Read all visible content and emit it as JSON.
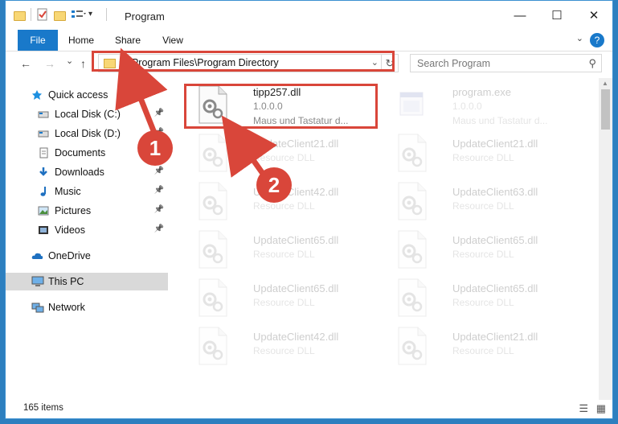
{
  "window": {
    "title": "Program",
    "controls": {
      "minimize": "—",
      "maximize": "☐",
      "close": "✕"
    }
  },
  "ribbon": {
    "tabs": [
      "File",
      "Home",
      "Share",
      "View"
    ],
    "help": "?"
  },
  "nav": {
    "back": "←",
    "forward": "→",
    "recent": "⌄",
    "up": "↑",
    "address_path": "C:\\Program Files\\Program Directory",
    "search_placeholder": "Search Program"
  },
  "sidebar": {
    "items": [
      {
        "label": "Quick access",
        "icon": "star-icon",
        "pinned": false
      },
      {
        "label": "Local Disk (C:)",
        "icon": "drive-icon",
        "pinned": true
      },
      {
        "label": "Local Disk (D:)",
        "icon": "drive-icon",
        "pinned": true
      },
      {
        "label": "Documents",
        "icon": "documents-icon",
        "pinned": true
      },
      {
        "label": "Downloads",
        "icon": "download-icon",
        "pinned": true
      },
      {
        "label": "Music",
        "icon": "music-icon",
        "pinned": true
      },
      {
        "label": "Pictures",
        "icon": "pictures-icon",
        "pinned": true
      },
      {
        "label": "Videos",
        "icon": "videos-icon",
        "pinned": true
      },
      {
        "label": "OneDrive",
        "icon": "cloud-icon",
        "pinned": false
      },
      {
        "label": "This PC",
        "icon": "computer-icon",
        "pinned": false
      },
      {
        "label": "Network",
        "icon": "network-icon",
        "pinned": false
      }
    ]
  },
  "files": [
    {
      "name": "tipp257.dll",
      "line2": "1.0.0.0",
      "line3": "Maus und Tastatur d..."
    },
    {
      "name": "program.exe",
      "line2": "1.0.0.0",
      "line3": "Maus und Tastatur d..."
    },
    {
      "name": "UpdateClient21.dll",
      "line2": "Resource DLL"
    },
    {
      "name": "UpdateClient21.dll",
      "line2": "Resource DLL"
    },
    {
      "name": "UpdateClient42.dll",
      "line2": "Resource DLL"
    },
    {
      "name": "UpdateClient63.dll",
      "line2": "Resource DLL"
    },
    {
      "name": "UpdateClient65.dll",
      "line2": "Resource DLL"
    },
    {
      "name": "UpdateClient65.dll",
      "line2": "Resource DLL"
    },
    {
      "name": "UpdateClient65.dll",
      "line2": "Resource DLL"
    },
    {
      "name": "UpdateClient65.dll",
      "line2": "Resource DLL"
    },
    {
      "name": "UpdateClient42.dll",
      "line2": "Resource DLL"
    },
    {
      "name": "UpdateClient21.dll",
      "line2": "Resource DLL"
    }
  ],
  "annotations": {
    "step1": "1",
    "step2": "2",
    "color": "#d9463a"
  },
  "status": {
    "item_count": "165 items"
  },
  "colors": {
    "accent": "#1979ca",
    "highlight": "#d9463a"
  }
}
